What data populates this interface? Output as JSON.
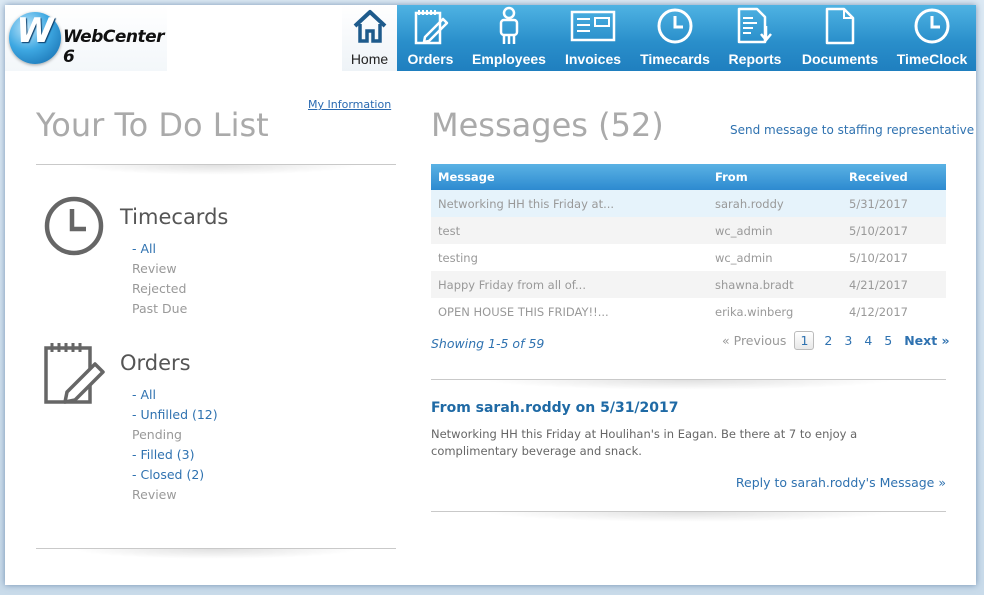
{
  "brand": {
    "logo_letter": "W",
    "name": "WebCenter 6"
  },
  "nav": [
    {
      "label": "Home",
      "icon": "home-icon",
      "active": true
    },
    {
      "label": "Orders",
      "icon": "notepad-pencil-icon"
    },
    {
      "label": "Employees",
      "icon": "person-icon"
    },
    {
      "label": "Invoices",
      "icon": "invoice-icon"
    },
    {
      "label": "Timecards",
      "icon": "clock-icon"
    },
    {
      "label": "Reports",
      "icon": "report-download-icon"
    },
    {
      "label": "Documents",
      "icon": "document-icon"
    },
    {
      "label": "TimeClock",
      "icon": "clock-icon"
    }
  ],
  "todo": {
    "title": "Your To Do List",
    "my_information": "My Information",
    "timecards": {
      "title": "Timecards",
      "items": [
        {
          "label": "- All",
          "active": true
        },
        {
          "label": "Review",
          "active": false
        },
        {
          "label": "Rejected",
          "active": false
        },
        {
          "label": "Past Due",
          "active": false
        }
      ]
    },
    "orders": {
      "title": "Orders",
      "items": [
        {
          "label": "- All",
          "active": true
        },
        {
          "label": "- Unfilled (12)",
          "active": true
        },
        {
          "label": "Pending",
          "active": false
        },
        {
          "label": "- Filled (3)",
          "active": true
        },
        {
          "label": "- Closed (2)",
          "active": true
        },
        {
          "label": "Review",
          "active": false
        }
      ]
    }
  },
  "messages": {
    "title": "Messages (52)",
    "send_link": "Send message to staffing representative",
    "columns": [
      "Message",
      "From",
      "Received"
    ],
    "rows": [
      {
        "message": "Networking HH this Friday at...",
        "from": "sarah.roddy",
        "received": "5/31/2017",
        "selected": true
      },
      {
        "message": "test",
        "from": "wc_admin",
        "received": "5/10/2017"
      },
      {
        "message": "testing",
        "from": "wc_admin",
        "received": "5/10/2017"
      },
      {
        "message": "Happy Friday from all of...",
        "from": "shawna.bradt",
        "received": "4/21/2017"
      },
      {
        "message": "OPEN HOUSE THIS FRIDAY!!...",
        "from": "erika.winberg",
        "received": "4/12/2017"
      }
    ],
    "showing": "Showing 1-5 of 59",
    "pager": {
      "previous": "« Previous",
      "pages": [
        "1",
        "2",
        "3",
        "4",
        "5"
      ],
      "current": "1",
      "next": "Next »"
    },
    "detail": {
      "heading": "From sarah.roddy on 5/31/2017",
      "body": "Networking HH this Friday at Houlihan's in Eagan. Be there at 7 to enjoy a complimentary beverage and snack.",
      "reply": "Reply to sarah.roddy's Message »"
    }
  },
  "colors": {
    "accent": "#2f72b0",
    "header_blue": "#2a8fcb",
    "muted": "#999999"
  }
}
